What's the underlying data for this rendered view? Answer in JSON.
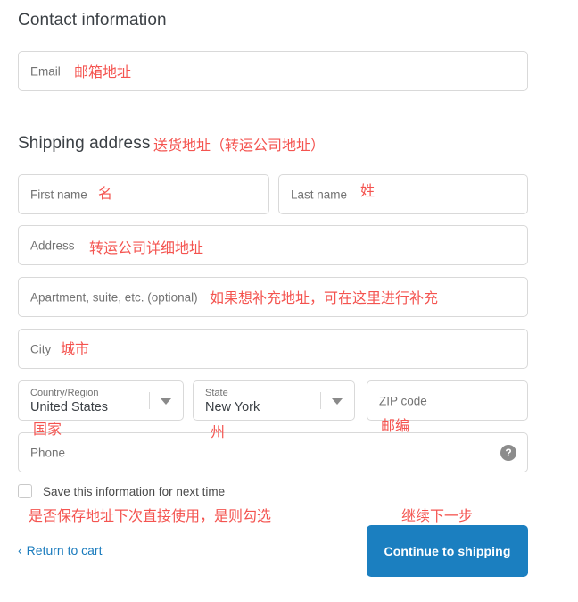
{
  "sections": {
    "contact_title": "Contact information",
    "shipping_title": "Shipping address"
  },
  "fields": {
    "email": {
      "placeholder": "Email"
    },
    "first_name": {
      "placeholder": "First name"
    },
    "last_name": {
      "placeholder": "Last name"
    },
    "address": {
      "placeholder": "Address"
    },
    "apartment": {
      "placeholder": "Apartment, suite, etc. (optional)"
    },
    "city": {
      "placeholder": "City"
    },
    "country": {
      "label": "Country/Region",
      "value": "United States"
    },
    "state": {
      "label": "State",
      "value": "New York"
    },
    "zip": {
      "placeholder": "ZIP code"
    },
    "phone": {
      "placeholder": "Phone",
      "help_icon": "?"
    }
  },
  "save_option": {
    "label": "Save this information for next time",
    "checked": false
  },
  "footer": {
    "return_chevron": "‹",
    "return_label": "Return to cart",
    "continue_label": "Continue to shipping"
  },
  "annotations": {
    "email": "邮箱地址",
    "shipping": "送货地址（转运公司地址）",
    "first_name": "名",
    "last_name": "姓",
    "address": "转运公司详细地址",
    "apartment": "如果想补充地址，可在这里进行补充",
    "city": "城市",
    "country": "国家",
    "state": "州",
    "zip": "邮编",
    "save": "是否保存地址下次直接使用，是则勾选",
    "continue": "继续下一步"
  },
  "colors": {
    "accent_blue": "#1b7fc0",
    "link_blue": "#1a7bbd",
    "annotation_red": "#f45450",
    "field_border": "#d9d9d9",
    "placeholder_gray": "#737373"
  }
}
